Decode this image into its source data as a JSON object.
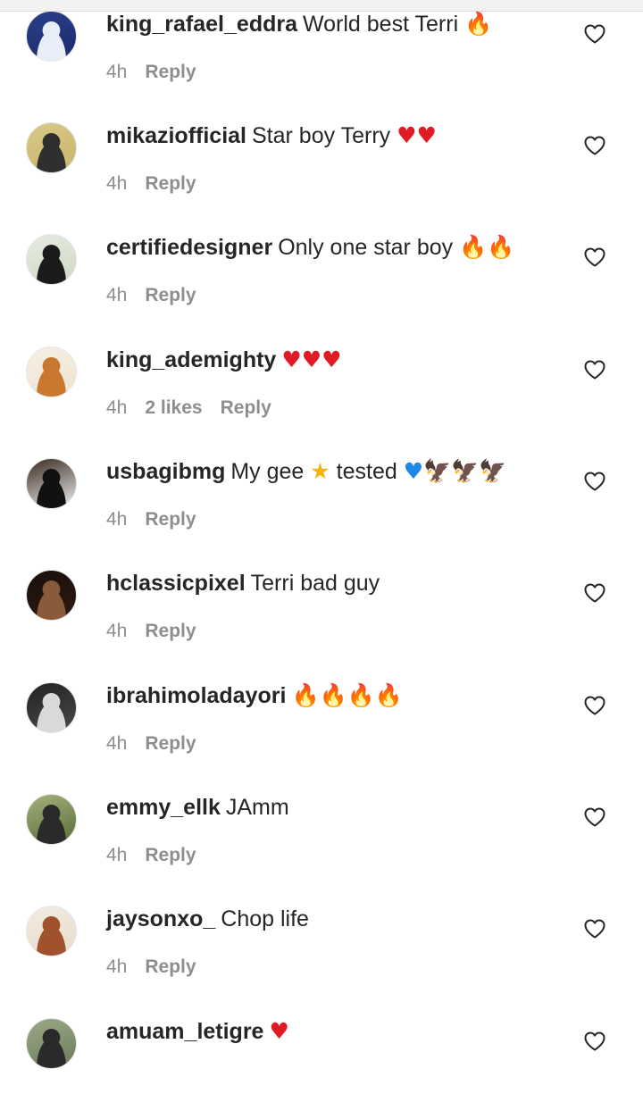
{
  "comments": [
    {
      "username": "king_rafael_eddra",
      "text": "World best Terri",
      "emojis": [
        {
          "glyph": "🔥",
          "kind": "fire"
        }
      ],
      "time": "4h",
      "likes": "",
      "reply": "Reply",
      "avatar_colors": [
        "#1a2a6b",
        "#e8eef7",
        "#2c3f8a"
      ]
    },
    {
      "username": "mikaziofficial",
      "text": "Star boy Terry",
      "emojis": [
        {
          "glyph": "♥",
          "kind": "heart"
        },
        {
          "glyph": "♥",
          "kind": "heart"
        }
      ],
      "time": "4h",
      "likes": "",
      "reply": "Reply",
      "avatar_colors": [
        "#c9b56a",
        "#2f2f2f",
        "#d8c98a"
      ]
    },
    {
      "username": "certifiedesigner",
      "text": "Only one star boy",
      "emojis": [
        {
          "glyph": "🔥",
          "kind": "fire"
        },
        {
          "glyph": "🔥",
          "kind": "fire"
        }
      ],
      "time": "4h",
      "likes": "",
      "reply": "Reply",
      "avatar_colors": [
        "#cfd8c4",
        "#1b1b1b",
        "#e6ebe0"
      ]
    },
    {
      "username": "king_ademighty",
      "text": "",
      "emojis": [
        {
          "glyph": "♥",
          "kind": "heart"
        },
        {
          "glyph": "♥",
          "kind": "heart"
        },
        {
          "glyph": "♥",
          "kind": "heart"
        }
      ],
      "time": "4h",
      "likes": "2 likes",
      "reply": "Reply",
      "avatar_colors": [
        "#efe4d2",
        "#c9772e",
        "#f6efe3"
      ]
    },
    {
      "username": "usbagibmg",
      "text": "My gee",
      "text2": "tested",
      "emojis_mid": [
        {
          "glyph": "★",
          "kind": "star"
        }
      ],
      "emojis": [
        {
          "glyph": "♥",
          "kind": "blueheart"
        },
        {
          "glyph": "🦅",
          "kind": "eagle"
        },
        {
          "glyph": "🦅",
          "kind": "eagle"
        },
        {
          "glyph": "🦅",
          "kind": "eagle"
        }
      ],
      "time": "4h",
      "likes": "",
      "reply": "Reply",
      "avatar_colors": [
        "#f2f2f2",
        "#111111",
        "#3a2a1f"
      ]
    },
    {
      "username": "hclassicpixel",
      "text": "Terri bad guy",
      "emojis": [],
      "time": "4h",
      "likes": "",
      "reply": "Reply",
      "avatar_colors": [
        "#2b1a12",
        "#8a5a3c",
        "#1a0f0a"
      ]
    },
    {
      "username": "ibrahimoladayori",
      "text": "",
      "emojis": [
        {
          "glyph": "🔥",
          "kind": "fire"
        },
        {
          "glyph": "🔥",
          "kind": "fire"
        },
        {
          "glyph": "🔥",
          "kind": "fire"
        },
        {
          "glyph": "🔥",
          "kind": "fire"
        }
      ],
      "time": "4h",
      "likes": "",
      "reply": "Reply",
      "avatar_colors": [
        "#4a4a4a",
        "#d9d9d9",
        "#222222"
      ]
    },
    {
      "username": "emmy_ellk",
      "text": "JAmm",
      "emojis": [],
      "time": "4h",
      "likes": "",
      "reply": "Reply",
      "avatar_colors": [
        "#5a6b3a",
        "#2a2a2a",
        "#a3b27a"
      ]
    },
    {
      "username": "jaysonxo_",
      "text": "Chop life",
      "emojis": [],
      "time": "4h",
      "likes": "",
      "reply": "Reply",
      "avatar_colors": [
        "#e7dccb",
        "#a0522d",
        "#f3ece1"
      ]
    },
    {
      "username": "amuam_letigre",
      "text": "",
      "emojis": [
        {
          "glyph": "♥",
          "kind": "heart"
        }
      ],
      "time": "",
      "likes": "",
      "reply": "",
      "avatar_colors": [
        "#6b7a5a",
        "#2a2a2a",
        "#9aaa88"
      ]
    }
  ],
  "like_icon": "heart-outline-icon"
}
